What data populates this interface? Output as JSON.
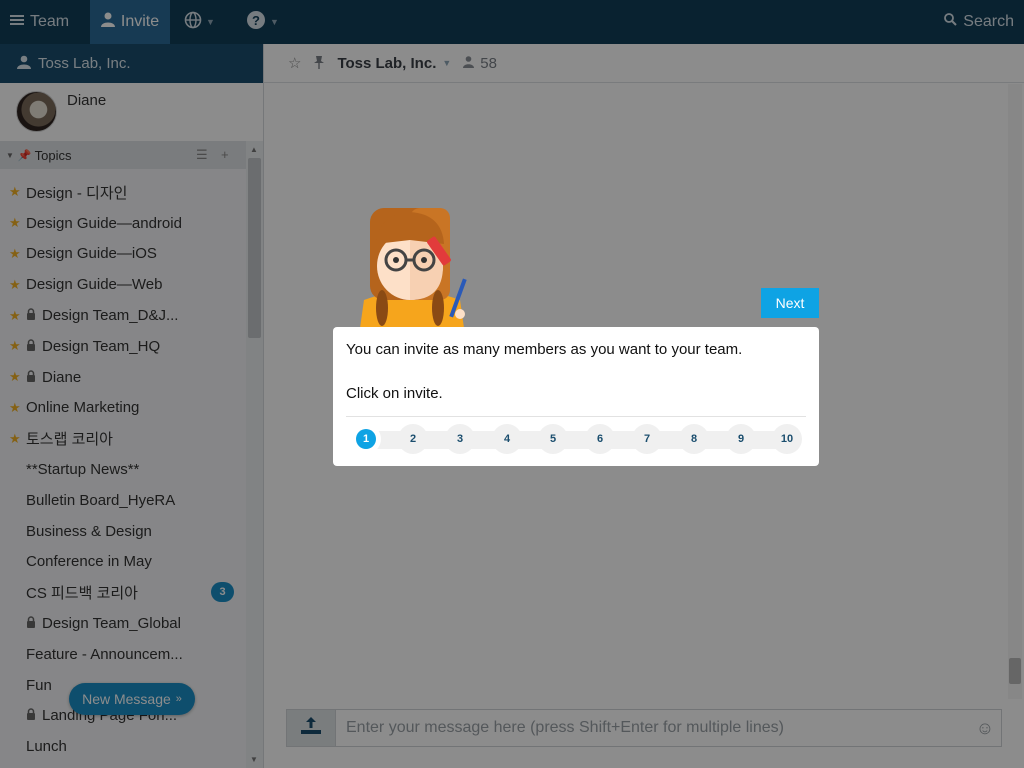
{
  "topbar": {
    "team_label": "Team",
    "invite_label": "Invite",
    "search_label": "Search"
  },
  "sidebar": {
    "team_name": "Toss Lab, Inc.",
    "profile_name": "Diane",
    "topics_label": "Topics",
    "topics": [
      {
        "label": "Design - 디자인",
        "starred": true,
        "locked": false
      },
      {
        "label": "Design Guide—android",
        "starred": true,
        "locked": false
      },
      {
        "label": "Design Guide—iOS",
        "starred": true,
        "locked": false
      },
      {
        "label": "Design Guide—Web",
        "starred": true,
        "locked": false
      },
      {
        "label": "Design Team_D&J...",
        "starred": true,
        "locked": true
      },
      {
        "label": "Design Team_HQ",
        "starred": true,
        "locked": true
      },
      {
        "label": "Diane",
        "starred": true,
        "locked": true
      },
      {
        "label": "Online Marketing",
        "starred": true,
        "locked": false
      },
      {
        "label": "토스랩 코리아",
        "starred": true,
        "locked": false
      },
      {
        "label": "**Startup News**",
        "starred": false,
        "locked": false
      },
      {
        "label": "Bulletin Board_HyeRA",
        "starred": false,
        "locked": false
      },
      {
        "label": "Business & Design",
        "starred": false,
        "locked": false
      },
      {
        "label": "Conference in May",
        "starred": false,
        "locked": false
      },
      {
        "label": "CS 피드백 코리아",
        "starred": false,
        "locked": false,
        "badge": "3"
      },
      {
        "label": "Design Team_Global",
        "starred": false,
        "locked": true
      },
      {
        "label": "Feature - Announcem...",
        "starred": false,
        "locked": false
      },
      {
        "label": "Fun",
        "starred": false,
        "locked": false
      },
      {
        "label": "Landing Page Fon...",
        "starred": false,
        "locked": true
      },
      {
        "label": "Lunch",
        "starred": false,
        "locked": false
      }
    ],
    "new_message_label": "New Message"
  },
  "room": {
    "title": "Toss Lab, Inc.",
    "member_count": "58"
  },
  "composer": {
    "placeholder": "Enter your message here (press Shift+Enter for multiple lines)"
  },
  "tour": {
    "next_label": "Next",
    "line1": "You can invite as many members as you want to your team.",
    "line2": "Click on invite.",
    "steps": [
      "1",
      "2",
      "3",
      "4",
      "5",
      "6",
      "7",
      "8",
      "9",
      "10"
    ],
    "current_step": "1"
  },
  "colors": {
    "topbar": "#123e58",
    "accent": "#0ea3e4",
    "badge": "#1a8fc7",
    "star": "#f3b125"
  }
}
